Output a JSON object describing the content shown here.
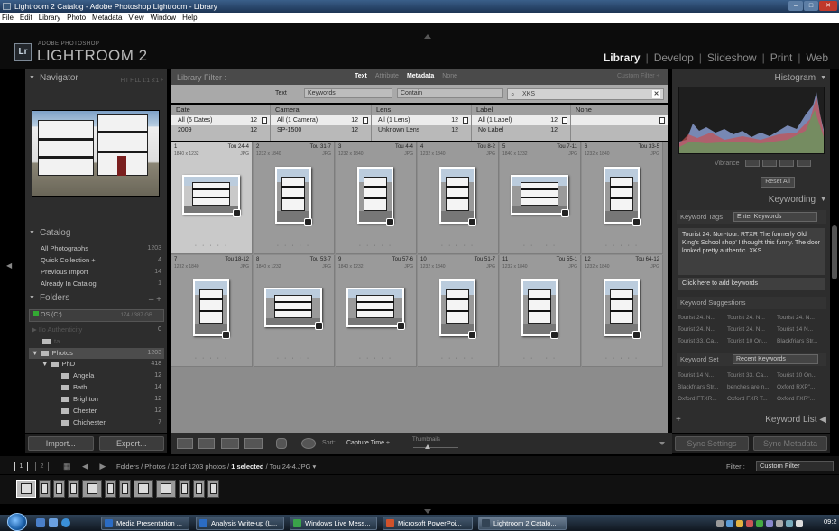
{
  "window": {
    "title": "Lightroom 2 Catalog - Adobe Photoshop Lightroom - Library"
  },
  "menu": [
    "File",
    "Edit",
    "Library",
    "Photo",
    "Metadata",
    "View",
    "Window",
    "Help"
  ],
  "brand": {
    "logo": "Lr",
    "product": "ADOBE PHOTOSHOP",
    "name": "LIGHTROOM 2"
  },
  "modules": [
    {
      "label": "Library",
      "active": true
    },
    {
      "label": "Develop"
    },
    {
      "label": "Slideshow"
    },
    {
      "label": "Print"
    },
    {
      "label": "Web"
    }
  ],
  "navigator": {
    "title": "Navigator",
    "options": "FIT  FILL  1:1  3:1 ÷"
  },
  "catalog": {
    "title": "Catalog",
    "items": [
      {
        "label": "All Photographs",
        "count": "1203"
      },
      {
        "label": "Quick Collection +",
        "count": "4"
      },
      {
        "label": "Previous Import",
        "count": "14"
      },
      {
        "label": "Already In Catalog",
        "count": "1"
      }
    ]
  },
  "folders": {
    "title": "Folders",
    "plus": "– +",
    "volume": {
      "label": "OS (C:)",
      "space": "174 / 387 GB"
    },
    "items": [
      {
        "label": "Ilo  Authenticity",
        "count": "0",
        "dim": true
      },
      {
        "label": "ta",
        "count": "",
        "dim": true
      },
      {
        "label": "Photos",
        "count": "1203",
        "sel": true
      },
      {
        "label": "PhD",
        "count": "418"
      },
      {
        "label": "Angela",
        "count": "12"
      },
      {
        "label": "Bath",
        "count": "14"
      },
      {
        "label": "Brighton",
        "count": "12"
      },
      {
        "label": "Chester",
        "count": "12"
      },
      {
        "label": "Chichester",
        "count": "7"
      }
    ]
  },
  "buttons": {
    "import": "Import...",
    "export": "Export...",
    "sync_settings": "Sync Settings",
    "sync_metadata": "Sync Metadata"
  },
  "filter": {
    "title": "Library Filter :",
    "tabs": [
      {
        "label": "Text",
        "active": true
      },
      {
        "label": "Attribute"
      },
      {
        "label": "Metadata",
        "active": true
      },
      {
        "label": "None"
      }
    ],
    "custom": "Custom Filter ÷",
    "text_label": "Text",
    "field": "Keywords",
    "rule": "Contain",
    "search": "XKS",
    "columns": [
      {
        "header": "Date",
        "rows": [
          {
            "label": "All (6 Dates)",
            "n": "12"
          },
          {
            "label": "2009",
            "n": "12"
          }
        ]
      },
      {
        "header": "Camera",
        "rows": [
          {
            "label": "All (1 Camera)",
            "n": "12"
          },
          {
            "label": "SP-1500",
            "n": "12"
          }
        ]
      },
      {
        "header": "Lens",
        "rows": [
          {
            "label": "All (1 Lens)",
            "n": "12"
          },
          {
            "label": "Unknown Lens",
            "n": "12"
          }
        ]
      },
      {
        "header": "Label",
        "rows": [
          {
            "label": "All (1 Label)",
            "n": "12"
          },
          {
            "label": "No Label",
            "n": "12"
          }
        ]
      },
      {
        "header": "None",
        "rows": []
      }
    ]
  },
  "grid": [
    {
      "idx": "1",
      "name": "Tou 24-4",
      "dim": "1840 x 1232",
      "ext": "JPG",
      "o": "l",
      "sel": true
    },
    {
      "idx": "2",
      "name": "Tou 31-7",
      "dim": "1232 x 1840",
      "ext": "JPG",
      "o": "p"
    },
    {
      "idx": "3",
      "name": "Tou 4-4",
      "dim": "1232 x 1840",
      "ext": "JPG",
      "o": "p"
    },
    {
      "idx": "4",
      "name": "Tou 8-2",
      "dim": "1232 x 1840",
      "ext": "JPG",
      "o": "p"
    },
    {
      "idx": "5",
      "name": "Tou 7-11",
      "dim": "1840 x 1232",
      "ext": "JPG",
      "o": "l"
    },
    {
      "idx": "6",
      "name": "Tou 33-5",
      "dim": "1232 x 1840",
      "ext": "JPG",
      "o": "p"
    },
    {
      "idx": "7",
      "name": "Tou 18-12",
      "dim": "1232 x 1840",
      "ext": "JPG",
      "o": "p"
    },
    {
      "idx": "8",
      "name": "Tou 53-7",
      "dim": "1840 x 1232",
      "ext": "JPG",
      "o": "l"
    },
    {
      "idx": "9",
      "name": "Tou 57-6",
      "dim": "1840 x 1232",
      "ext": "JPG",
      "o": "l"
    },
    {
      "idx": "10",
      "name": "Tou 51-7",
      "dim": "1232 x 1840",
      "ext": "JPG",
      "o": "p"
    },
    {
      "idx": "11",
      "name": "Tou 55-1",
      "dim": "1232 x 1840",
      "ext": "JPG",
      "o": "p"
    },
    {
      "idx": "12",
      "name": "Tou 64-12",
      "dim": "1232 x 1840",
      "ext": "JPG",
      "o": "p"
    }
  ],
  "toolbar": {
    "sort_label": "Sort:",
    "sort_value": "Capture Time ÷",
    "thumbs_label": "Thumbnails"
  },
  "right": {
    "histogram": "Histogram",
    "vibrance": "Vibrance",
    "reset": "Reset All",
    "keywording": "Keywording",
    "kw_tags": "Keyword Tags",
    "kw_tags_sel": "Enter Keywords",
    "kw_text": "Tourist 24. Non-tour. RTXR The formerly Old King's School shop' I thought this funny. The door looked pretty authentic. XKS",
    "kw_add": "Click here to add keywords",
    "kw_suggestions": "Keyword Suggestions",
    "suggestions": [
      "Tourist 24. N...",
      "Tourist 24. N...",
      "Tourist 24. N...",
      "Tourist 24. N...",
      "Tourist 24. N...",
      "Tourist 14 N...",
      "Tourist 33. Ca...",
      "Tourist 10 On...",
      "Blackfriars Str..."
    ],
    "kw_set": "Keyword Set",
    "kw_set_sel": "Recent Keywords",
    "set": [
      "Tourist 14 N...",
      "Tourist 33. Ca...",
      "Tourist 10 On...",
      "Blackfriars Str...",
      "benches are n...",
      "Oxford RXP\"...",
      "Oxford FTXR...",
      "Oxford FXR T...",
      "Oxford FXR\"..."
    ],
    "kw_list": "Keyword List"
  },
  "filmstrip": {
    "num1": "1",
    "num2": "2",
    "path_pre": "Folders / Photos / 12 of 1203 photos /",
    "path_sel": "1 selected",
    "path_post": "/ Tou 24-4.JPG ▾",
    "filter_label": "Filter :",
    "filter_value": "Custom Filter"
  },
  "taskbar": {
    "buttons": [
      {
        "label": "Media Presentation ...",
        "color": "#2b6cc4"
      },
      {
        "label": "Analysis Write-up (L...",
        "color": "#2b6cc4"
      },
      {
        "label": "Windows Live Mess...",
        "color": "#3aa34a"
      },
      {
        "label": "Microsoft PowerPoi...",
        "color": "#d1522b"
      },
      {
        "label": "Lightroom 2 Catalo...",
        "color": "#345",
        "active": true
      }
    ],
    "clock": "09:2"
  }
}
